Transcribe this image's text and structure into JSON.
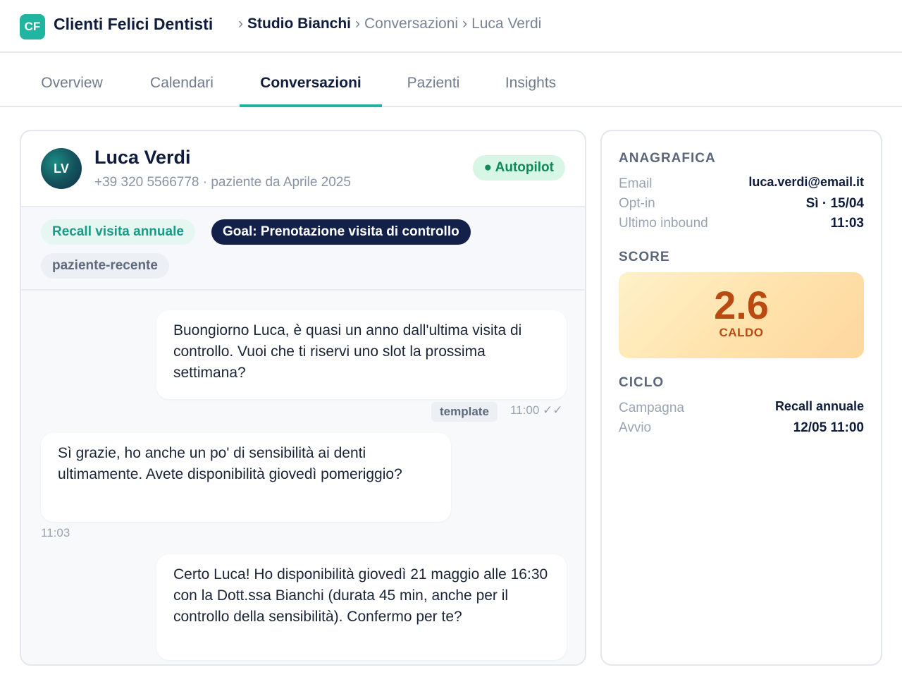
{
  "header": {
    "logo_text": "CF",
    "brand": "Clienti Felici Dentisti",
    "breadcrumb": {
      "sep": "›",
      "studio": "Studio Bianchi",
      "section": "Conversazioni",
      "patient": "Luca Verdi"
    }
  },
  "tabs": [
    {
      "label": "Overview"
    },
    {
      "label": "Calendari"
    },
    {
      "label": "Conversazioni"
    },
    {
      "label": "Pazienti"
    },
    {
      "label": "Insights"
    }
  ],
  "conversation": {
    "avatar_initials": "LV",
    "name": "Luca Verdi",
    "subtitle": "+39 320 5566778 · paziente da Aprile 2025",
    "status_badge": "● Autopilot",
    "tags": {
      "campaign": "Recall visita annuale",
      "goal": "Goal: Prenotazione visita di controllo",
      "label": "paziente-recente"
    },
    "messages": [
      {
        "text": "Buongiorno Luca, è quasi un anno dall'ultima visita di controllo. Vuoi che ti riservi uno slot la prossima settimana?",
        "tag": "template",
        "time": "11:00",
        "status": "✓✓"
      },
      {
        "text": "Sì grazie, ho anche un po' di sensibilità ai denti ultimamente. Avete disponibilità giovedì pomeriggio?",
        "time": "11:03"
      },
      {
        "text": "Certo Luca! Ho disponibilità giovedì 21 maggio alle 16:30 con la Dott.ssa Bianchi (durata 45 min, anche per il controllo della sensibilità). Confermo per te?"
      }
    ]
  },
  "sidebar": {
    "anagrafica": {
      "title": "ANAGRAFICA",
      "email_label": "Email",
      "email_value": "luca.verdi@email.it",
      "optin_label": "Opt-in",
      "optin_value": "Sì · 15/04",
      "inbound_label": "Ultimo inbound",
      "inbound_value": "11:03"
    },
    "score": {
      "title": "SCORE",
      "value": "2.6",
      "label": "CALDO"
    },
    "ciclo": {
      "title": "CICLO",
      "campaign_label": "Campagna",
      "campaign_value": "Recall annuale",
      "start_label": "Avvio",
      "start_value": "12/05 11:00"
    }
  },
  "colors": {
    "accent": "#1fb5a0",
    "navy": "#0f1c3d",
    "autopilot_bg": "#d7f6e6",
    "autopilot_text": "#0d8a5b",
    "score_text": "#b84a12"
  }
}
